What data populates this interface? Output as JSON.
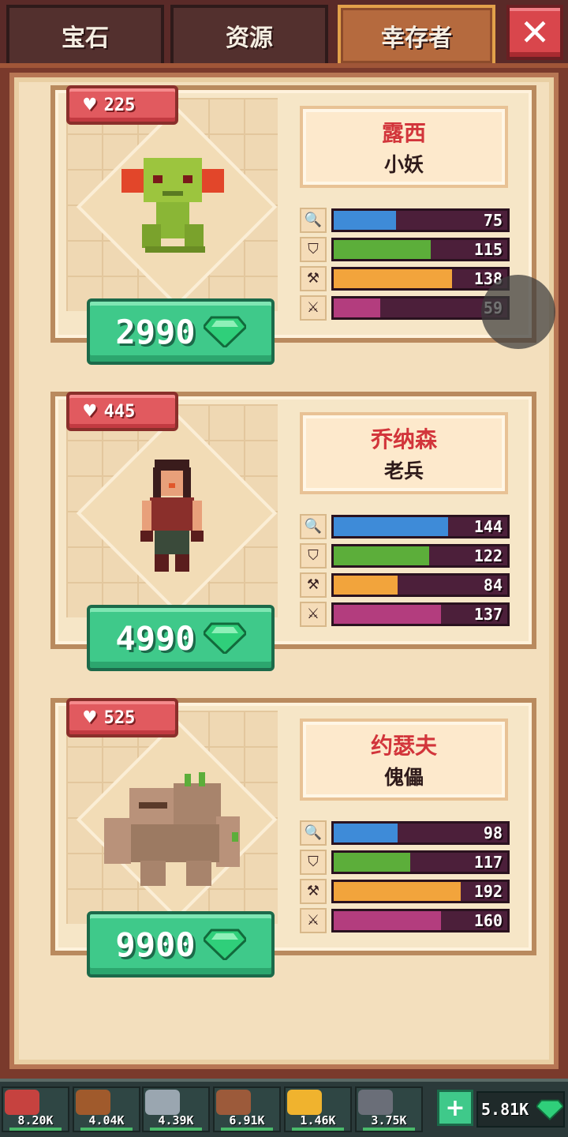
{
  "tabs": [
    {
      "label": "宝石",
      "active": false
    },
    {
      "label": "资源",
      "active": false
    },
    {
      "label": "幸存者",
      "active": true
    }
  ],
  "close_icon": "close-icon",
  "stat_icons": [
    "magnifier-icon",
    "shield-icon",
    "axe-icon",
    "sword-icon"
  ],
  "colors": {
    "bar_blue": "#3e8bd8",
    "bar_green": "#5cae3a",
    "bar_orange": "#f2a43c",
    "bar_purple": "#b33d7e",
    "bar_track": "#4c1f3a",
    "price_green": "#3fc98a",
    "name_red": "#d2353b",
    "gem_green": "#2fcf7a"
  },
  "survivors": [
    {
      "hp": "225",
      "name": "露西",
      "type": "小妖",
      "stats": [
        {
          "value": "75",
          "fraction": 0.36
        },
        {
          "value": "115",
          "fraction": 0.56
        },
        {
          "value": "138",
          "fraction": 0.68
        },
        {
          "value": "59",
          "fraction": 0.27
        }
      ],
      "price": "2990"
    },
    {
      "hp": "445",
      "name": "乔纳森",
      "type": "老兵",
      "stats": [
        {
          "value": "144",
          "fraction": 0.66
        },
        {
          "value": "122",
          "fraction": 0.55
        },
        {
          "value": "84",
          "fraction": 0.37
        },
        {
          "value": "137",
          "fraction": 0.62
        }
      ],
      "price": "4990"
    },
    {
      "hp": "525",
      "name": "约瑟夫",
      "type": "傀儡",
      "stats": [
        {
          "value": "98",
          "fraction": 0.37
        },
        {
          "value": "117",
          "fraction": 0.44
        },
        {
          "value": "192",
          "fraction": 0.73
        },
        {
          "value": "160",
          "fraction": 0.62
        }
      ],
      "price": "9900"
    }
  ],
  "resources": [
    {
      "name": "meat",
      "icon": "meat-icon",
      "amount": "8.20K",
      "color": "#c6423f"
    },
    {
      "name": "wood",
      "icon": "log-icon",
      "amount": "4.04K",
      "color": "#a05a2c"
    },
    {
      "name": "iron",
      "icon": "iron-ingot-icon",
      "amount": "4.39K",
      "color": "#9aa6b0"
    },
    {
      "name": "leather",
      "icon": "rope-icon",
      "amount": "6.91K",
      "color": "#9c5a3a"
    },
    {
      "name": "gold",
      "icon": "gold-ore-icon",
      "amount": "1.46K",
      "color": "#f0b32e"
    },
    {
      "name": "stone",
      "icon": "stone-icon",
      "amount": "3.75K",
      "color": "#6a6e78"
    }
  ],
  "gem_total": "5.81K"
}
